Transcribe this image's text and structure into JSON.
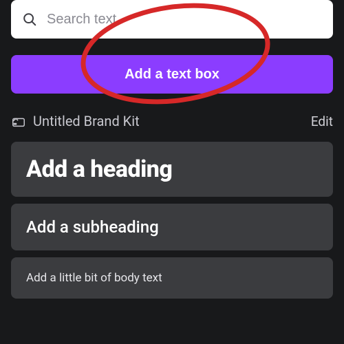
{
  "search": {
    "placeholder": "Search text"
  },
  "buttons": {
    "add_text_box": "Add a text box"
  },
  "brand_kit": {
    "name": "Untitled Brand Kit",
    "edit_label": "Edit"
  },
  "text_styles": {
    "heading_label": "Add a heading",
    "subheading_label": "Add a subheading",
    "body_label": "Add a little bit of body text"
  },
  "colors": {
    "accent": "#8b3dff",
    "panel_bg": "#18191b",
    "card_bg": "#3b3c3f"
  }
}
